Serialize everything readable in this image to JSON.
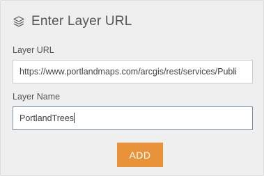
{
  "dialog": {
    "title": "Enter Layer URL",
    "icon": "layers-icon"
  },
  "form": {
    "url_label": "Layer URL",
    "url_value": "https://www.portlandmaps.com/arcgis/rest/services/Publi",
    "name_label": "Layer Name",
    "name_value": "PortlandTrees"
  },
  "actions": {
    "add_label": "ADD"
  },
  "colors": {
    "panel_bg": "#efefef",
    "button_accent": "#e8923a",
    "focused_border": "#7a8fa8"
  }
}
